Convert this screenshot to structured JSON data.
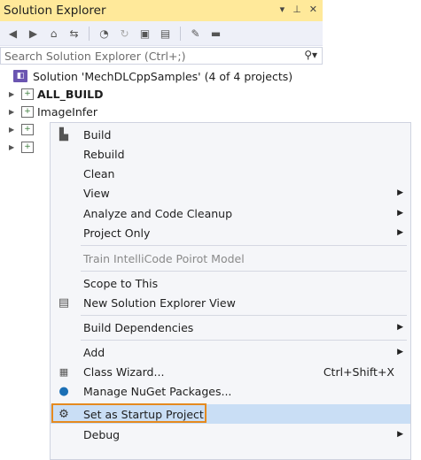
{
  "panel": {
    "title": "Solution Explorer"
  },
  "title_icons": {
    "dropdown": "▾",
    "pin": "⊥",
    "close": "✕"
  },
  "toolbar": {
    "icons": [
      "back-icon",
      "forward-icon",
      "home-icon",
      "sync-icon",
      "history-icon",
      "refresh-icon",
      "collapse-icon",
      "show-all-icon",
      "properties-icon",
      "preview-icon"
    ]
  },
  "search": {
    "placeholder": "Search Solution Explorer (Ctrl+;)"
  },
  "tree": {
    "solution": "Solution 'MechDLCppSamples' (4 of 4 projects)",
    "items": [
      {
        "label": "ALL_BUILD",
        "bold": true
      },
      {
        "label": "ImageInfer",
        "bold": false
      },
      {
        "label": "",
        "bold": false
      },
      {
        "label": "",
        "bold": false
      }
    ]
  },
  "context_menu": {
    "items": [
      {
        "label": "Build",
        "icon": "build-icon"
      },
      {
        "label": "Rebuild"
      },
      {
        "label": "Clean"
      },
      {
        "label": "View",
        "submenu": true
      },
      {
        "label": "Analyze and Code Cleanup",
        "submenu": true
      },
      {
        "label": "Project Only",
        "submenu": true
      },
      {
        "label": "Train IntelliCode Poirot Model",
        "disabled": true
      },
      {
        "label": "Scope to This"
      },
      {
        "label": "New Solution Explorer View",
        "icon": "new-view-icon"
      },
      {
        "label": "Build Dependencies",
        "submenu": true
      },
      {
        "label": "Add",
        "submenu": true
      },
      {
        "label": "Class Wizard...",
        "shortcut": "Ctrl+Shift+X",
        "icon": "class-wizard-icon"
      },
      {
        "label": "Manage NuGet Packages...",
        "icon": "nuget-icon"
      },
      {
        "label": "Set as Startup Project",
        "icon": "gear-icon",
        "highlighted": true
      },
      {
        "label": "Debug",
        "submenu": true
      }
    ]
  },
  "colors": {
    "title_bg": "#ffe99a",
    "highlight": "#c9def5",
    "highlight_border": "#e58a1f"
  }
}
